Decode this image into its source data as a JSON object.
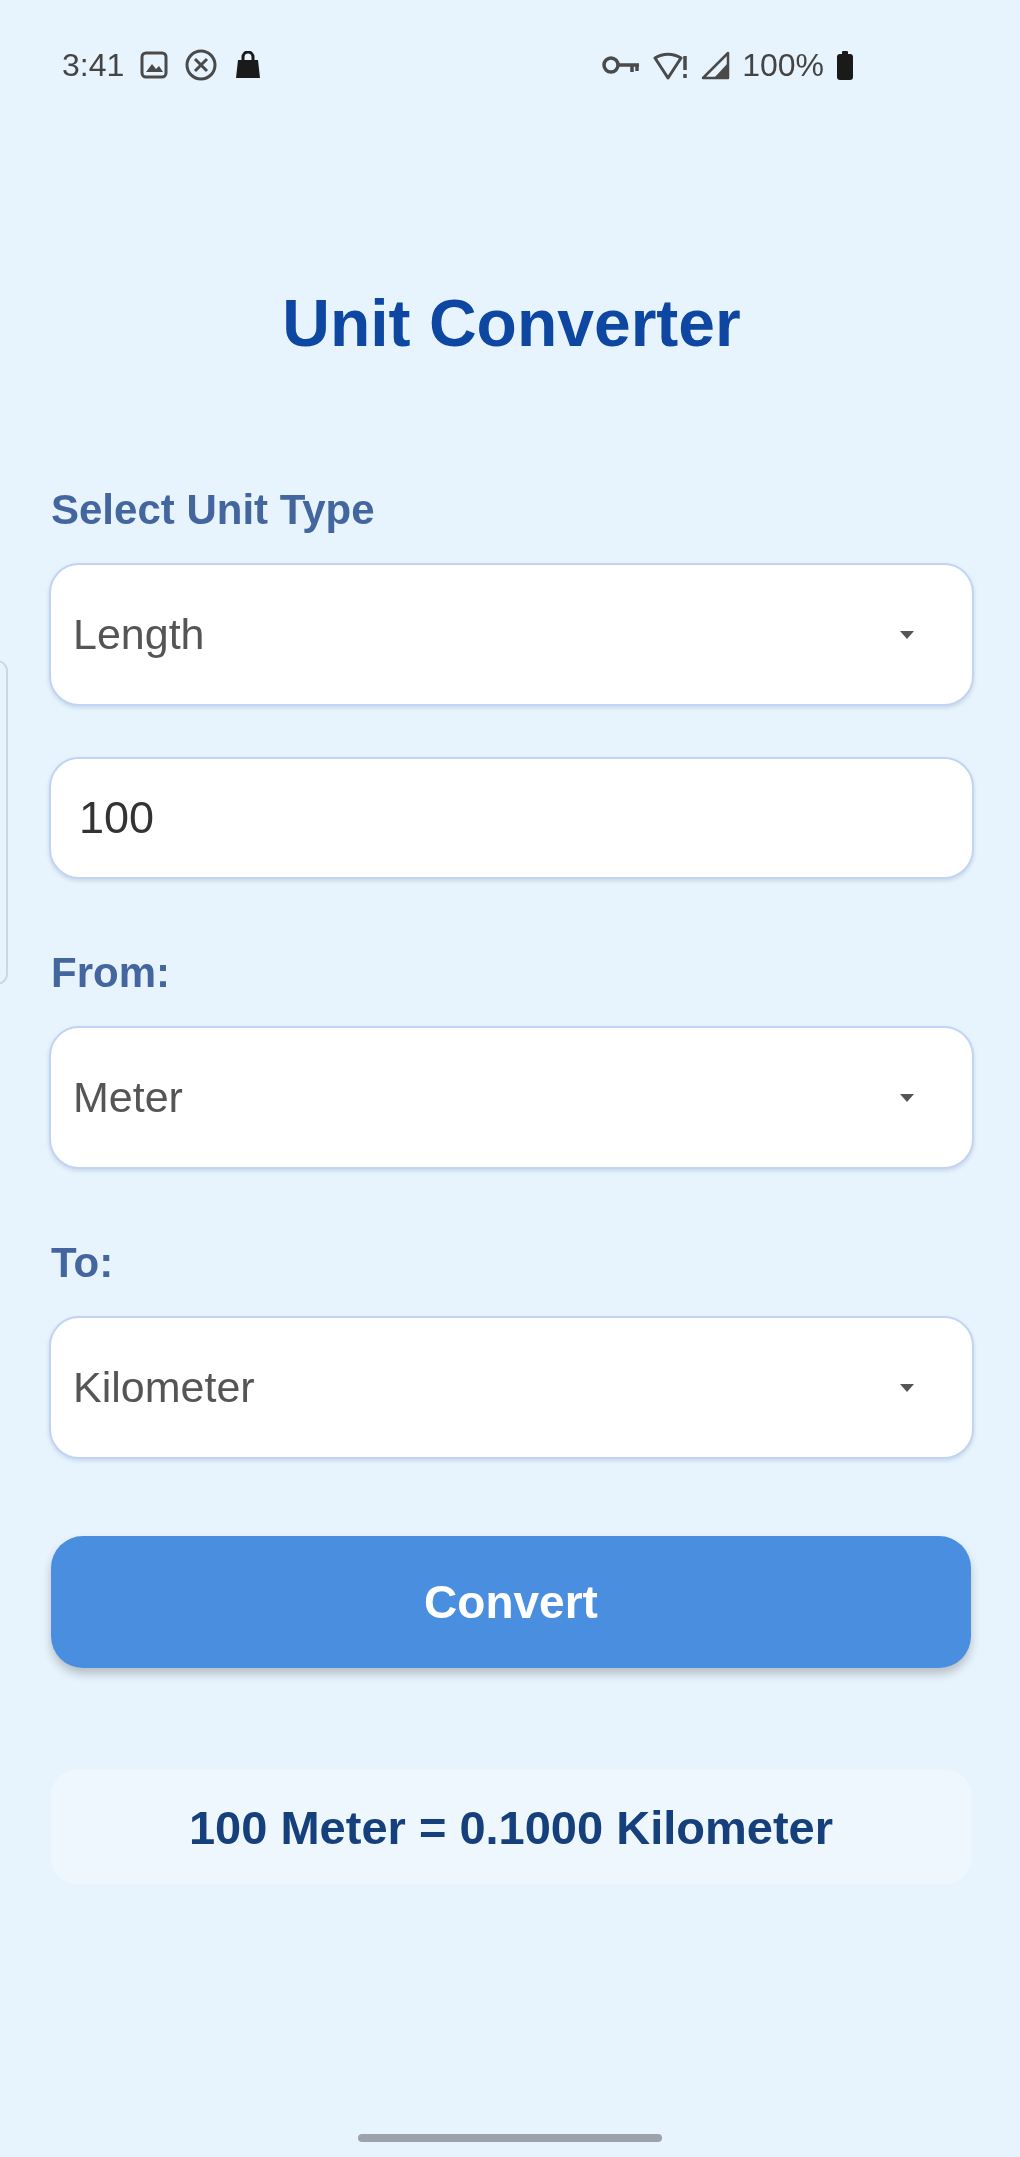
{
  "status_bar": {
    "time": "3:41",
    "battery": "100%"
  },
  "title": "Unit Converter",
  "form": {
    "fields": [
      {
        "kind": "label",
        "text": "Select Unit Type"
      },
      {
        "kind": "dropdown",
        "value": "Length"
      },
      {
        "kind": "input",
        "value": "100"
      },
      {
        "kind": "label",
        "text": "From:"
      },
      {
        "kind": "dropdown",
        "value": "Meter"
      },
      {
        "kind": "label",
        "text": "To:"
      },
      {
        "kind": "dropdown",
        "value": "Kilometer"
      }
    ]
  },
  "convert_button": {
    "label": "Convert"
  },
  "result": {
    "text": "100 Meter = 0.1000 Kilometer"
  }
}
